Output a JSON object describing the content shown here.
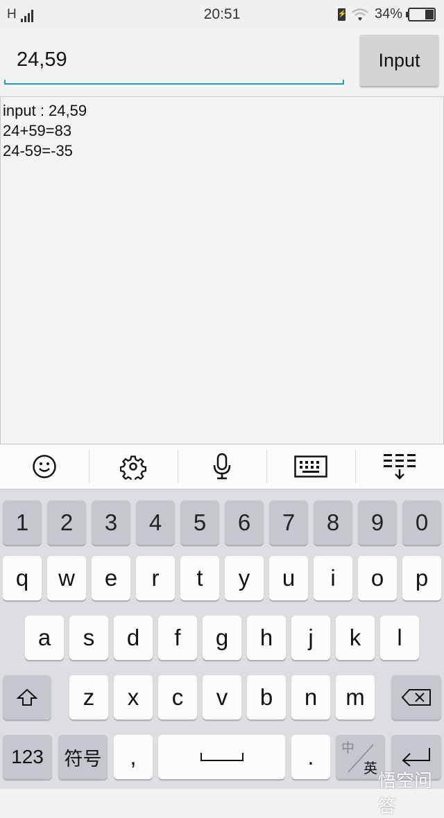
{
  "status_bar": {
    "network": "H",
    "time": "20:51",
    "battery_percent": "34%",
    "battery_level": 0.34
  },
  "input": {
    "value": "24,59",
    "button_label": "Input"
  },
  "output": {
    "lines": [
      "input : 24,59",
      "24+59=83",
      "24-59=-35"
    ]
  },
  "keyboard_toolbar": {
    "items": [
      "emoji-icon",
      "settings-icon",
      "microphone-icon",
      "keyboard-icon",
      "hide-keyboard-icon"
    ]
  },
  "keyboard": {
    "number_row": [
      "1",
      "2",
      "3",
      "4",
      "5",
      "6",
      "7",
      "8",
      "9",
      "0"
    ],
    "row1": [
      "q",
      "w",
      "e",
      "r",
      "t",
      "y",
      "u",
      "i",
      "o",
      "p"
    ],
    "row2": [
      "a",
      "s",
      "d",
      "f",
      "g",
      "h",
      "j",
      "k",
      "l"
    ],
    "row3": [
      "z",
      "x",
      "c",
      "v",
      "b",
      "n",
      "m"
    ],
    "bottom": {
      "numbers": "123",
      "symbols": "符号",
      "comma": ",",
      "period": ".",
      "lang_top": "中",
      "lang_bottom": "英"
    }
  },
  "watermark": "悟空问答"
}
